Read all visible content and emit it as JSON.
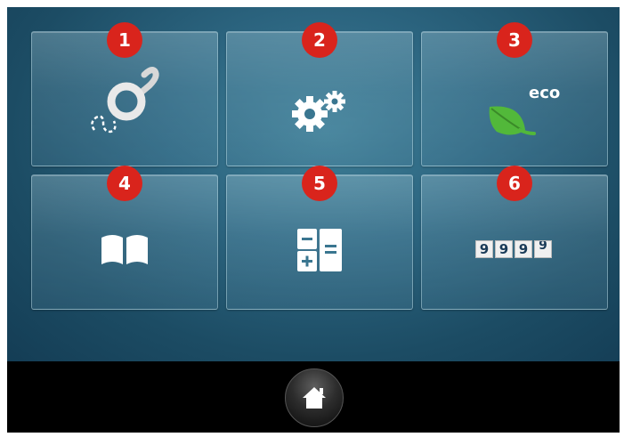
{
  "tiles": [
    {
      "number": "1",
      "icon": "needle-threader-icon"
    },
    {
      "number": "2",
      "icon": "gears-icon"
    },
    {
      "number": "3",
      "icon": "eco-leaf-icon",
      "text": "eco"
    },
    {
      "number": "4",
      "icon": "book-icon"
    },
    {
      "number": "5",
      "icon": "calculator-icon"
    },
    {
      "number": "6",
      "icon": "stitch-counter-icon",
      "digits": [
        "9",
        "9",
        "9",
        "9"
      ]
    }
  ],
  "home": {
    "icon": "home-icon"
  },
  "colors": {
    "badge": "#d9241c",
    "background": "#1c4c64",
    "leaf": "#4caf3a"
  }
}
